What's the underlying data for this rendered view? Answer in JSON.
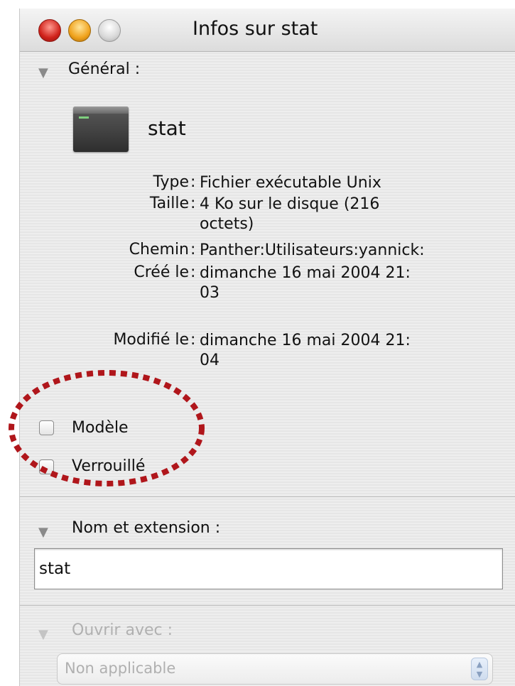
{
  "window": {
    "title": "Infos sur stat"
  },
  "general": {
    "label": "Général :",
    "file_name": "stat",
    "info": [
      {
        "label": "Type",
        "lines": [
          "Fichier exécutable Unix"
        ]
      },
      {
        "label": "Taille",
        "lines": [
          "4 Ko sur le disque (216",
          "octets)"
        ]
      },
      {
        "label": "Chemin",
        "lines": [
          "Panther:Utilisateurs:yannick:"
        ]
      },
      {
        "label": "Créé le",
        "lines": [
          "dimanche 16 mai 2004 21:",
          "03"
        ]
      },
      {
        "label": "Modifié le",
        "lines": [
          "dimanche 16 mai 2004 21:",
          "04"
        ]
      }
    ],
    "checkboxes": [
      {
        "label": "Modèle",
        "checked": false
      },
      {
        "label": "Verrouillé",
        "checked": false
      }
    ]
  },
  "name_extension": {
    "label": "Nom et extension :",
    "value": "stat"
  },
  "open_with": {
    "label": "Ouvrir avec :",
    "selected": "Non applicable"
  },
  "colors": {
    "annotation": "#b0161b",
    "disabled_text": "#b0b0b0"
  },
  "icons": {
    "disclosure": "disclosure-triangle-icon",
    "file": "unix-executable-icon",
    "popup": "updown-arrows-icon"
  }
}
